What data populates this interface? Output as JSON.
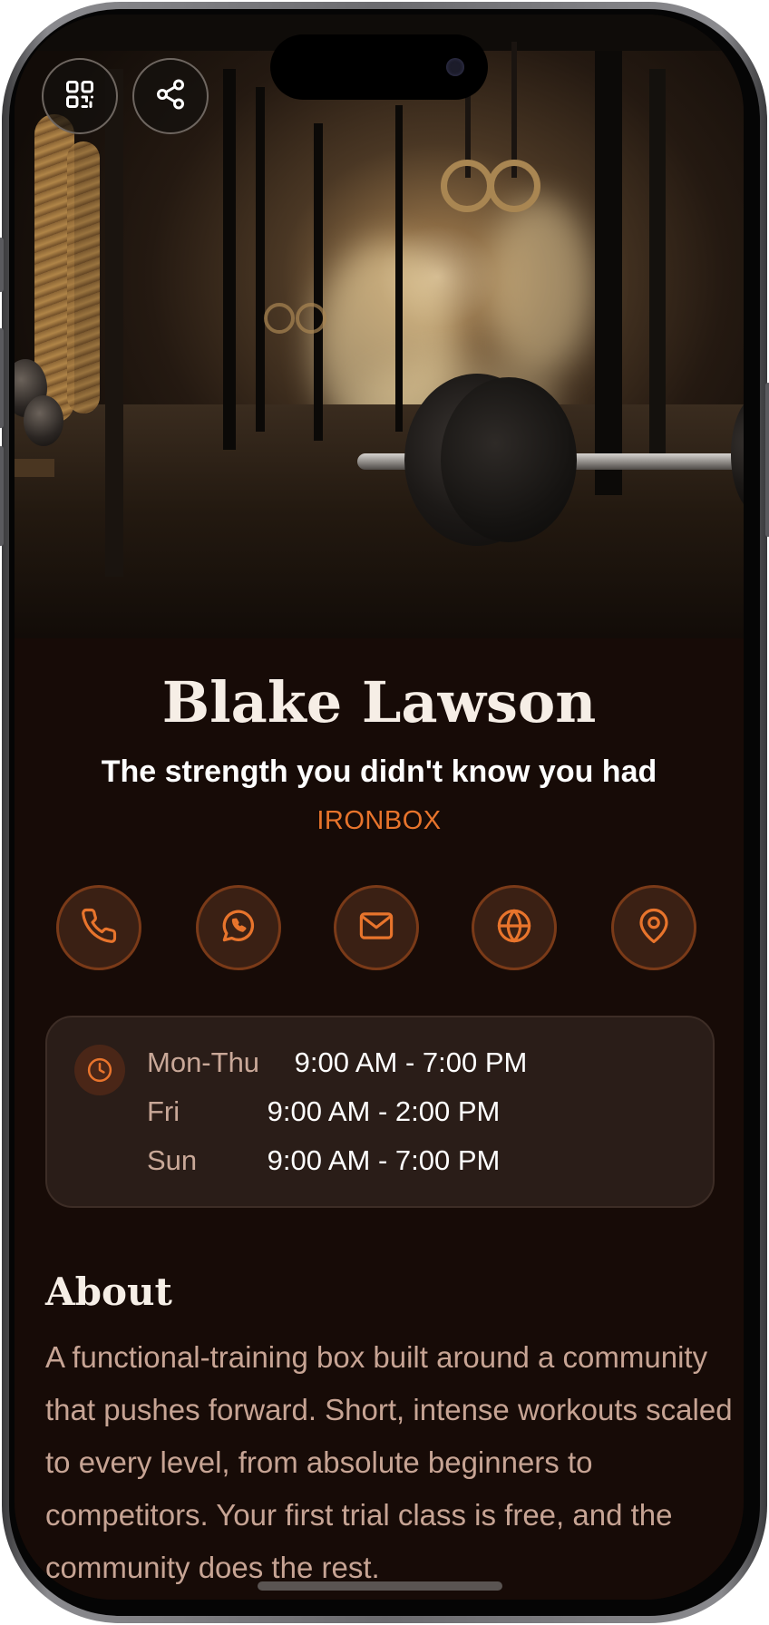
{
  "header": {
    "qr_icon": "qr-code-icon",
    "share_icon": "share-icon"
  },
  "profile": {
    "name": "Blake Lawson",
    "tagline": "The strength you didn't know you had",
    "company": "IRONBOX"
  },
  "contact_actions": [
    {
      "icon": "phone-icon"
    },
    {
      "icon": "whatsapp-icon"
    },
    {
      "icon": "mail-icon"
    },
    {
      "icon": "globe-icon"
    },
    {
      "icon": "map-pin-icon"
    }
  ],
  "hours": {
    "icon": "clock-icon",
    "rows": [
      {
        "day": "Mon-Thu",
        "time": "9:00 AM - 7:00 PM"
      },
      {
        "day": "Fri",
        "time": "9:00 AM - 2:00 PM"
      },
      {
        "day": "Sun",
        "time": "9:00 AM - 7:00 PM"
      }
    ]
  },
  "about": {
    "title": "About",
    "text": "A functional-training box built around a community that pushes forward. Short, intense workouts scaled to every level, from absolute beginners to competitors. Your first trial class is free, and the community does the rest."
  },
  "colors": {
    "accent": "#e8742c",
    "background": "#170b07",
    "card": "#2a1d18"
  }
}
